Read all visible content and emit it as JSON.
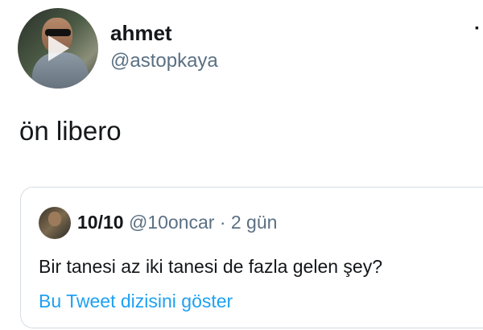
{
  "author": {
    "name": "ahmet",
    "handle": "@astopkaya"
  },
  "tweet": {
    "text": "ön libero"
  },
  "quoted_tweet": {
    "name": "10/10",
    "handle": "@10oncar",
    "separator": "·",
    "time": "2 gün",
    "text": "Bir tanesi az iki tanesi de fazla gelen şey?",
    "thread_link": "Bu Tweet dizisini göster"
  },
  "colors": {
    "primary_text": "#14171a",
    "secondary_text": "#5b7083",
    "link": "#1da1f2",
    "border": "#d6dde3"
  }
}
